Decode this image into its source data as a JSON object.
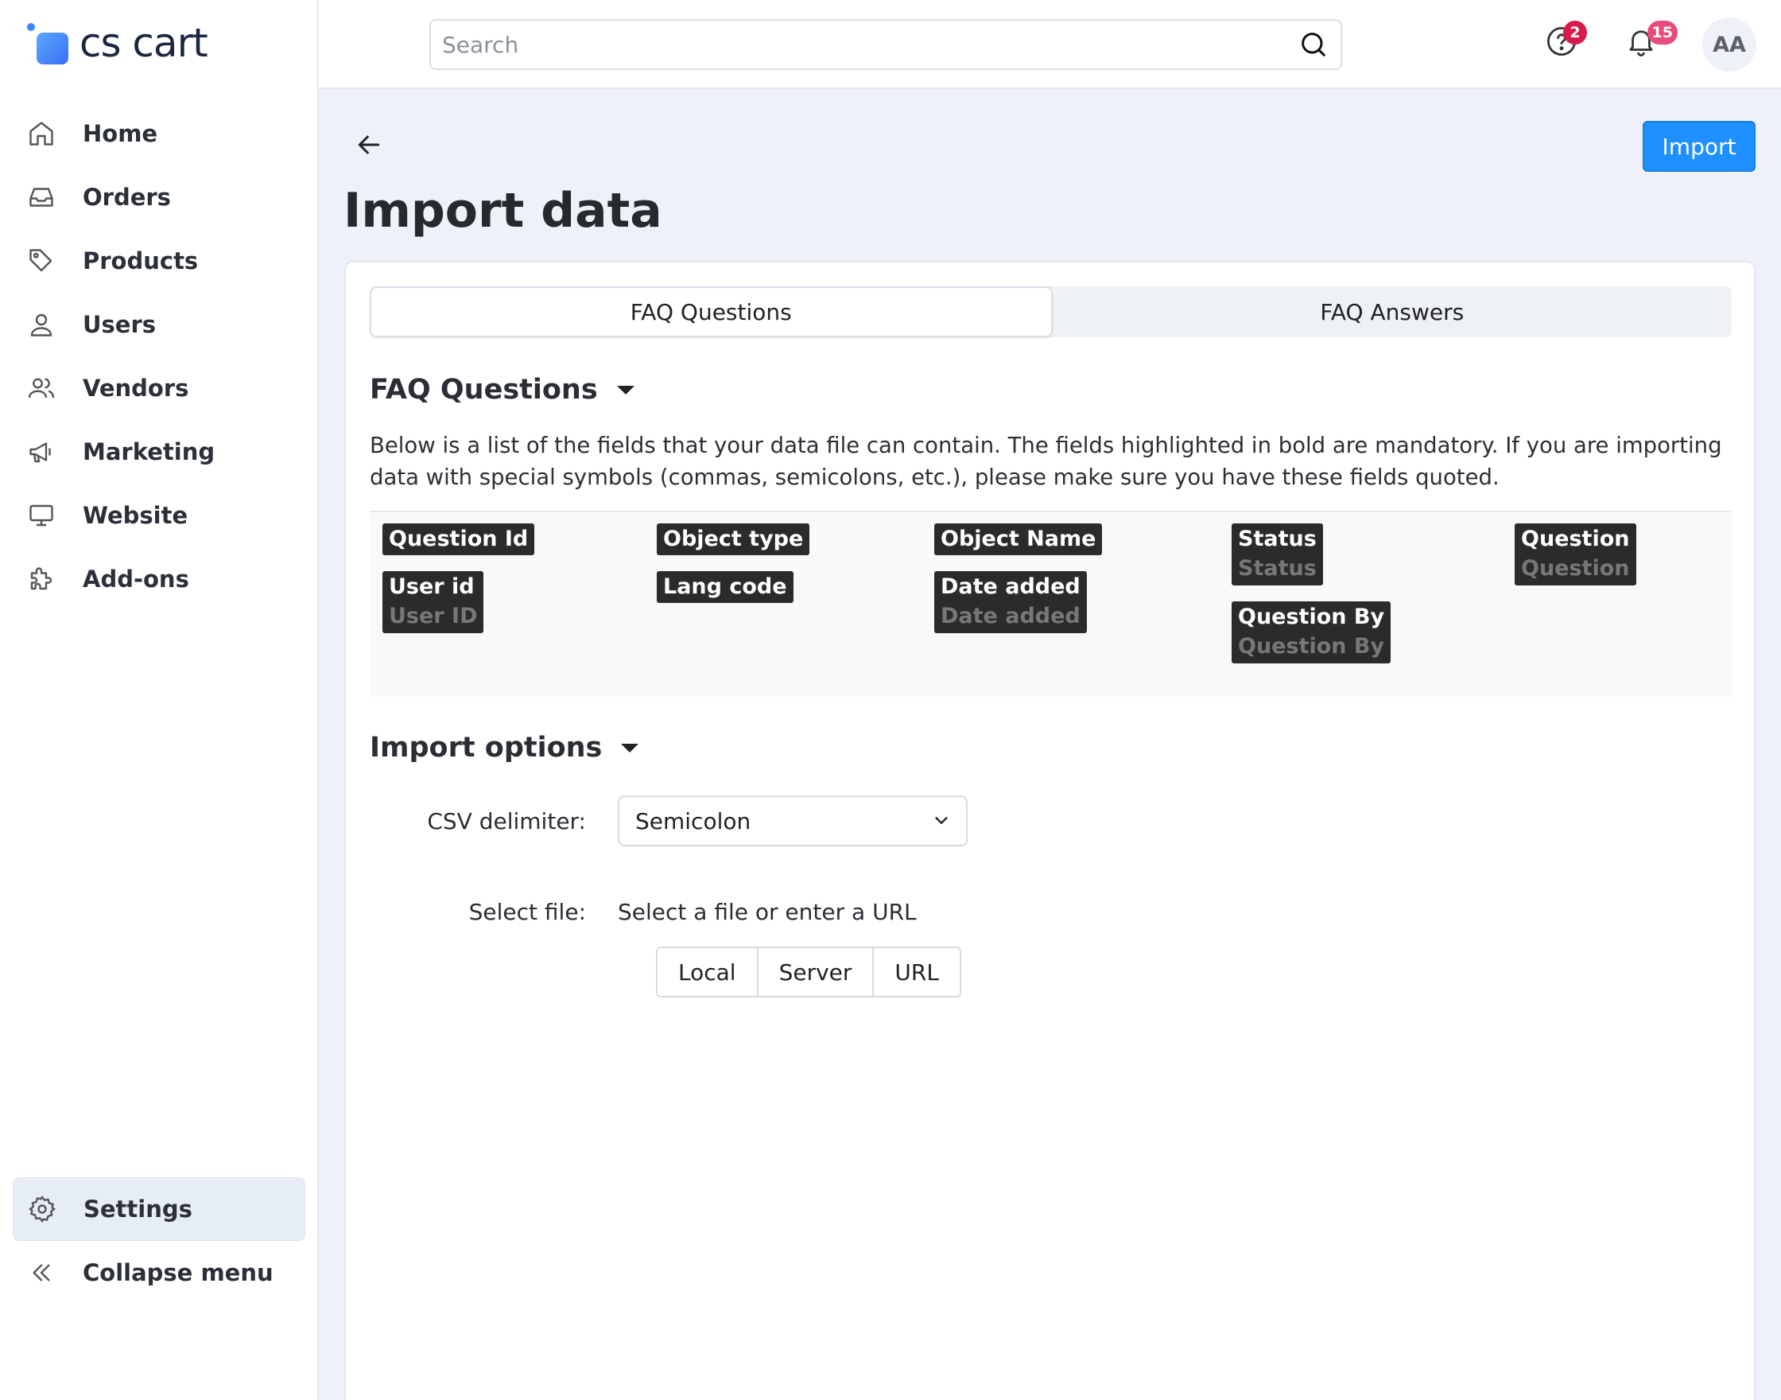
{
  "brand": {
    "logo_text": "cs cart",
    "accent": "#1e90ff"
  },
  "sidebar": {
    "items": [
      {
        "label": "Home",
        "icon": "home-icon"
      },
      {
        "label": "Orders",
        "icon": "inbox-icon"
      },
      {
        "label": "Products",
        "icon": "tag-icon"
      },
      {
        "label": "Users",
        "icon": "user-icon"
      },
      {
        "label": "Vendors",
        "icon": "users-icon"
      },
      {
        "label": "Marketing",
        "icon": "megaphone-icon"
      },
      {
        "label": "Website",
        "icon": "monitor-icon"
      },
      {
        "label": "Add-ons",
        "icon": "puzzle-icon"
      }
    ],
    "settings_label": "Settings",
    "collapse_label": "Collapse menu"
  },
  "topbar": {
    "search_placeholder": "Search",
    "help_badge": "2",
    "notifications_badge": "15",
    "avatar_initials": "AA"
  },
  "page": {
    "title": "Import data",
    "import_button": "Import"
  },
  "tabs": [
    {
      "label": "FAQ Questions",
      "active": true
    },
    {
      "label": "FAQ Answers",
      "active": false
    }
  ],
  "fields_section": {
    "title": "FAQ Questions",
    "description": "Below is a list of the fields that your data file can contain. The fields highlighted in bold are mandatory. If you are importing data with special symbols (commas, semicolons, etc.), please make sure you have these fields quoted.",
    "columns": [
      [
        {
          "name": "Question Id",
          "alt": ""
        },
        {
          "name": "User id",
          "alt": "User ID"
        }
      ],
      [
        {
          "name": "Object type",
          "alt": ""
        },
        {
          "name": "Lang code",
          "alt": ""
        }
      ],
      [
        {
          "name": "Object Name",
          "alt": ""
        },
        {
          "name": "Date added",
          "alt": "Date added"
        }
      ],
      [
        {
          "name": "Status",
          "alt": "Status"
        },
        {
          "name": "Question By",
          "alt": "Question By"
        }
      ],
      [
        {
          "name": "Question",
          "alt": "Question"
        }
      ]
    ]
  },
  "import_options": {
    "title": "Import options",
    "csv_label": "CSV delimiter:",
    "csv_value": "Semicolon",
    "file_label": "Select file:",
    "file_hint": "Select a file or enter a URL",
    "file_sources": [
      "Local",
      "Server",
      "URL"
    ]
  }
}
